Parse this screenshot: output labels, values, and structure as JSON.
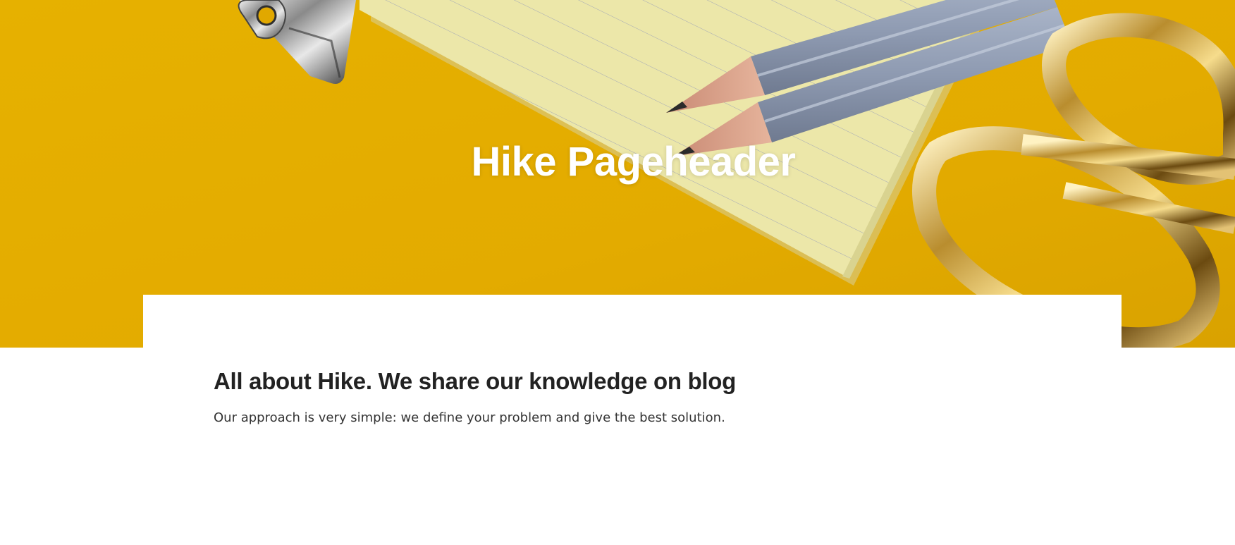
{
  "hero": {
    "title": "Hike Pageheader",
    "colors": {
      "background": "#e2ac00",
      "title": "#ffffff"
    },
    "image_icons": [
      "binder-clip-icon",
      "notepad-icon",
      "pencil-icon",
      "scissors-icon"
    ]
  },
  "content": {
    "title": "All about Hike. We share our knowledge on blog",
    "text": "Our approach is very simple: we define your problem and give the best solution.",
    "colors": {
      "card_background": "#ffffff",
      "title": "#222222",
      "text": "#333333"
    }
  }
}
